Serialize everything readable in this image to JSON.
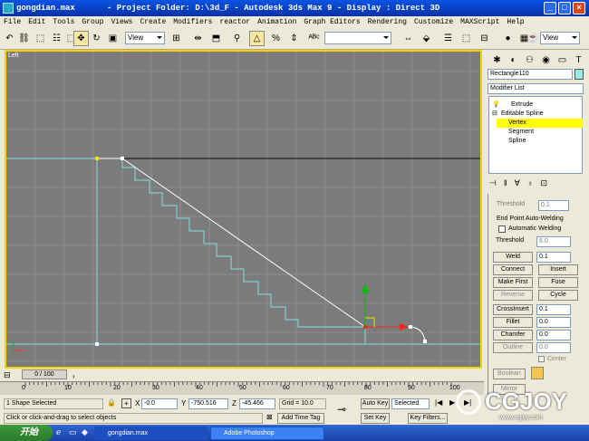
{
  "window": {
    "title_file": "gongdian.max",
    "title_rest": "- Project Folder: D:\\3d_F - Autodesk 3ds Max 9 - Display : Direct 3D"
  },
  "menu": [
    "File",
    "Edit",
    "Tools",
    "Group",
    "Views",
    "Create",
    "Modifiers",
    "reactor",
    "Animation",
    "Graph Editors",
    "Rendering",
    "Customize",
    "MAXScript",
    "Help"
  ],
  "toolbar": {
    "view_dropdown_1": "View",
    "view_dropdown_2": "View",
    "selection_set": ""
  },
  "viewport": {
    "label": "Left"
  },
  "command_panel": {
    "object_name": "Rectangle110",
    "object_color": "#99e6e6",
    "modifier_list": "Modifier List",
    "stack": {
      "extrude": "Extrude",
      "editable_spline": "Editable Spline",
      "vertex": "Vertex",
      "segment": "Segment",
      "spline": "Spline"
    },
    "threshold_top_label": "Threshold",
    "threshold_top_value": "0.1",
    "end_point_group": "End Point Auto-Welding",
    "auto_weld": "Automatic Welding",
    "threshold_label": "Threshold",
    "threshold_value": "6.0",
    "weld": "Weld",
    "weld_value": "0.1",
    "connect": "Connect",
    "insert": "Insert",
    "make_first": "Make First",
    "fuse": "Fuse",
    "reverse": "Reverse",
    "cycle": "Cycle",
    "crossinsert": "CrossInsert",
    "crossinsert_value": "0.1",
    "fillet": "Fillet",
    "fillet_value": "0.0",
    "chamfer": "Chamfer",
    "chamfer_value": "0.0",
    "outline": "Outline",
    "outline_value": "0.0",
    "center": "Center",
    "boolean": "Boolean",
    "mirror": "Mirror"
  },
  "timeline": {
    "frame": "0 / 100",
    "ticks": [
      "0",
      "10",
      "20",
      "30",
      "40",
      "50",
      "60",
      "70",
      "80",
      "90",
      "100"
    ]
  },
  "status": {
    "selected": "1 Shape Selected",
    "prompt": "Click or click-and-drag to select objects",
    "x_label": "X",
    "x": "-0.0",
    "y_label": "Y",
    "y": "-750.516",
    "z_label": "Z",
    "z": "-45.466",
    "grid": "Grid = 10.0",
    "add_time_tag": "Add Time Tag",
    "auto_key": "Auto Key",
    "auto_key_mode": "Selected",
    "set_key": "Set Key",
    "key_filters": "Key Filters..."
  },
  "taskbar": {
    "start": "开始",
    "task1": "gongdian.max",
    "task2": "Adobe Photoshop"
  },
  "watermark": {
    "brand": "CGJOY",
    "url": "www.cgjoy.com"
  }
}
